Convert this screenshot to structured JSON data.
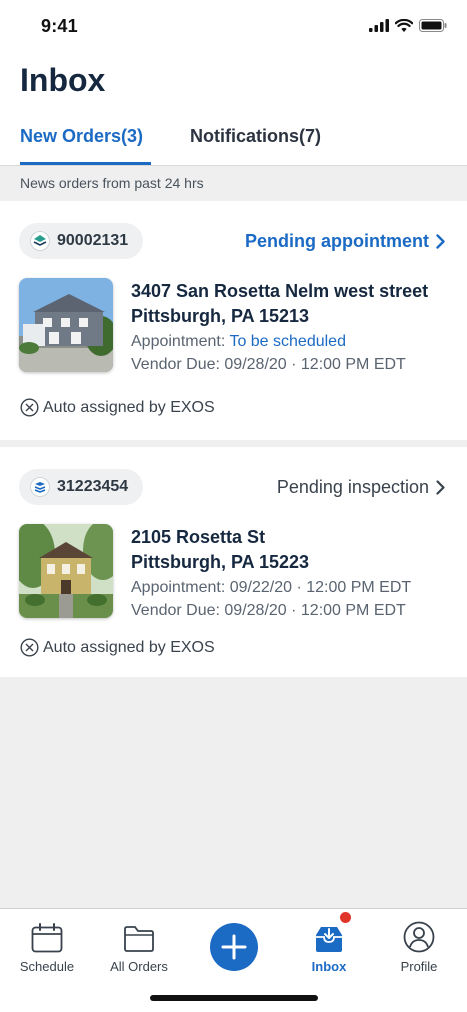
{
  "status_bar": {
    "time": "9:41"
  },
  "header": {
    "title": "Inbox",
    "tabs": [
      {
        "label": "New Orders(3)",
        "active": true
      },
      {
        "label": "Notifications(7)",
        "active": false
      }
    ]
  },
  "subheader": "News orders from past 24 hrs",
  "orders": [
    {
      "order_id": "90002131",
      "status": "Pending appointment",
      "address_line1": "3407 San Rosetta Nelm west street",
      "address_line2": "Pittsburgh, PA 15213",
      "appointment_label": "Appointment:",
      "appointment_value": "To be scheduled",
      "vendor_due": "Vendor Due: 09/28/20 · 12:00 PM EDT",
      "auto_assigned": "Auto assigned by EXOS"
    },
    {
      "order_id": "31223454",
      "status": "Pending inspection",
      "address_line1": "2105 Rosetta St",
      "address_line2": "Pittsburgh, PA 15223",
      "appointment_label": "Appointment:",
      "appointment_value": "09/22/20 · 12:00 PM EDT",
      "vendor_due": "Vendor Due: 09/28/20 · 12:00 PM EDT",
      "auto_assigned": "Auto assigned by EXOS"
    }
  ],
  "tab_bar": {
    "items": [
      {
        "label": "Schedule",
        "icon": "calendar-icon"
      },
      {
        "label": "All Orders",
        "icon": "folder-icon"
      },
      {
        "label": "",
        "icon": "plus-icon"
      },
      {
        "label": "Inbox",
        "icon": "inbox-icon",
        "active": true,
        "badge": true
      },
      {
        "label": "Profile",
        "icon": "profile-icon"
      }
    ]
  },
  "colors": {
    "accent": "#1b6ac4",
    "badge": "#e0352b",
    "title": "#16283f"
  }
}
